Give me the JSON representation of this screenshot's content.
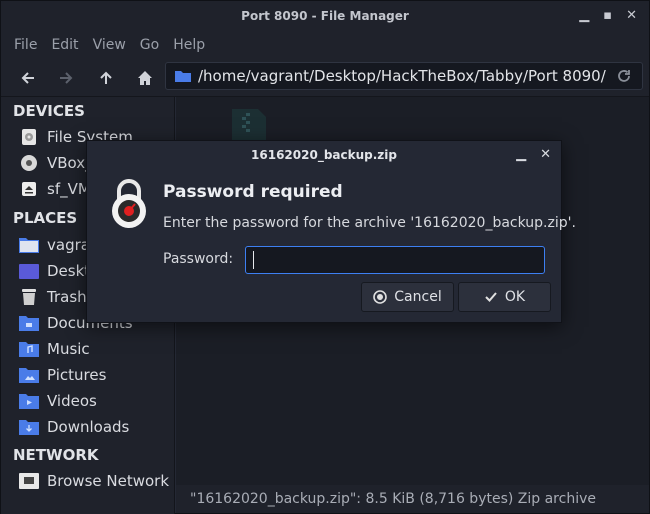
{
  "window": {
    "title": "Port 8090 - File Manager"
  },
  "menu": [
    "File",
    "Edit",
    "View",
    "Go",
    "Help"
  ],
  "location": {
    "path": "/home/vagrant/Desktop/HackTheBox/Tabby/Port 8090/"
  },
  "sidebar": {
    "devices_title": "DEVICES",
    "devices": [
      {
        "label": "File System",
        "icon": "drive-icon"
      },
      {
        "label": "VBox_",
        "icon": "optical-disc-icon"
      },
      {
        "label": "sf_VM",
        "icon": "eject-drive-icon"
      }
    ],
    "places_title": "PLACES",
    "places": [
      {
        "label": "vagra",
        "icon": "home-folder-icon"
      },
      {
        "label": "Deskt",
        "icon": "desktop-folder-icon"
      },
      {
        "label": "Trash",
        "icon": "trash-icon"
      },
      {
        "label": "Documents",
        "icon": "documents-folder-icon"
      },
      {
        "label": "Music",
        "icon": "music-folder-icon"
      },
      {
        "label": "Pictures",
        "icon": "pictures-folder-icon"
      },
      {
        "label": "Videos",
        "icon": "videos-folder-icon"
      },
      {
        "label": "Downloads",
        "icon": "downloads-folder-icon"
      }
    ],
    "network_title": "NETWORK",
    "network": [
      {
        "label": "Browse Network",
        "icon": "network-icon"
      }
    ]
  },
  "status": {
    "text": "\"16162020_backup.zip\": 8.5 KiB (8,716 bytes) Zip archive"
  },
  "dialog": {
    "title": "16162020_backup.zip",
    "heading": "Password required",
    "message": "Enter the password for the archive '16162020_backup.zip'.",
    "password_label": "Password:",
    "password_value": "",
    "cancel_label": "Cancel",
    "ok_label": "OK"
  },
  "colors": {
    "accent": "#3d7ff2",
    "folder": "#4a7ce8",
    "background": "#242834"
  }
}
